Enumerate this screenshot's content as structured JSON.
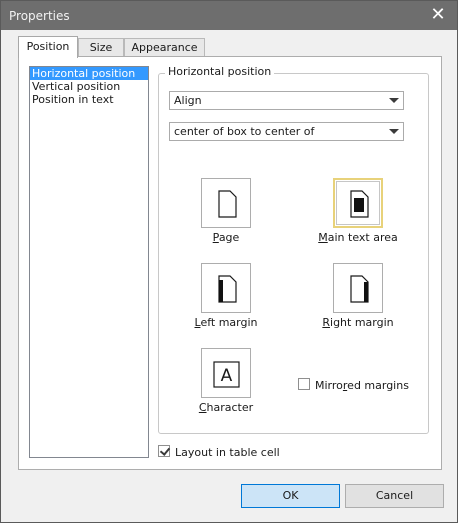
{
  "window": {
    "title": "Properties"
  },
  "tabs": [
    {
      "label": "Position",
      "active": true
    },
    {
      "label": "Size",
      "active": false
    },
    {
      "label": "Appearance",
      "active": false
    }
  ],
  "list": {
    "items": [
      {
        "label": "Horizontal position",
        "selected": true
      },
      {
        "label": "Vertical position",
        "selected": false
      },
      {
        "label": "Position in text",
        "selected": false
      }
    ]
  },
  "group": {
    "label": "Horizontal position",
    "mode_select": {
      "value": "Align"
    },
    "anchor_select": {
      "value": "center of box to center of"
    },
    "options": [
      {
        "key": "page",
        "prefix": "",
        "mnemonic": "P",
        "rest": "age",
        "selected": false
      },
      {
        "key": "main-text-area",
        "prefix": "",
        "mnemonic": "M",
        "rest": "ain text area",
        "selected": true
      },
      {
        "key": "left-margin",
        "prefix": "",
        "mnemonic": "L",
        "rest": "eft margin",
        "selected": false
      },
      {
        "key": "right-margin",
        "prefix": "",
        "mnemonic": "R",
        "rest": "ight margin",
        "selected": false
      },
      {
        "key": "character",
        "prefix": "",
        "mnemonic": "C",
        "rest": "haracter",
        "selected": false
      }
    ],
    "character_glyph": "A",
    "mirrored": {
      "prefix": "Mirro",
      "mnemonic": "r",
      "rest": "ed margins",
      "checked": false
    }
  },
  "layout_in_table_cell": {
    "label": "Layout in table cell",
    "checked": true
  },
  "buttons": {
    "ok": "OK",
    "cancel": "Cancel"
  },
  "colors": {
    "selection": "#3399ff",
    "default_button": "#cce4f7",
    "selected_option_border": "#e8d27a"
  }
}
